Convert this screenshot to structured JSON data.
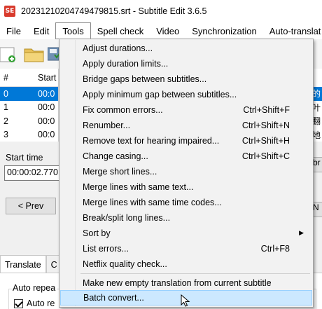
{
  "window": {
    "title": "20231210204749479815.srt - Subtitle Edit 3.6.5",
    "app_icon_text": "SE"
  },
  "menubar": {
    "items": [
      {
        "label": "File"
      },
      {
        "label": "Edit"
      },
      {
        "label": "Tools"
      },
      {
        "label": "Spell check"
      },
      {
        "label": "Video"
      },
      {
        "label": "Synchronization"
      },
      {
        "label": "Auto-translat"
      }
    ]
  },
  "grid": {
    "headers": {
      "num": "#",
      "start": "Start"
    },
    "rows": [
      {
        "num": "0",
        "start": "00:0",
        "text": "的"
      },
      {
        "num": "1",
        "start": "00:0",
        "text": "叶"
      },
      {
        "num": "2",
        "start": "00:0",
        "text": "翻"
      },
      {
        "num": "3",
        "start": "00:0",
        "text": "地"
      }
    ]
  },
  "edit": {
    "start_time_label": "Start time",
    "start_time_value": "00:00:02.770",
    "prev_button": "< Prev",
    "right_button_1": "br",
    "right_button_2": "N"
  },
  "bottom": {
    "tabs": [
      {
        "label": "Translate"
      },
      {
        "label": "C"
      }
    ],
    "group_label": "Auto repea",
    "checkbox_label": "Auto re"
  },
  "tools_menu": {
    "items": [
      {
        "label": "Adjust durations...",
        "shortcut": ""
      },
      {
        "label": "Apply duration limits...",
        "shortcut": ""
      },
      {
        "label": "Bridge gaps between subtitles...",
        "shortcut": ""
      },
      {
        "label": "Apply minimum gap between subtitles...",
        "shortcut": ""
      },
      {
        "label": "Fix common errors...",
        "shortcut": "Ctrl+Shift+F"
      },
      {
        "label": "Renumber...",
        "shortcut": "Ctrl+Shift+N"
      },
      {
        "label": "Remove text for hearing impaired...",
        "shortcut": "Ctrl+Shift+H"
      },
      {
        "label": "Change casing...",
        "shortcut": "Ctrl+Shift+C"
      },
      {
        "label": "Merge short lines...",
        "shortcut": ""
      },
      {
        "label": "Merge lines with same text...",
        "shortcut": ""
      },
      {
        "label": "Merge lines with same time codes...",
        "shortcut": ""
      },
      {
        "label": "Break/split long lines...",
        "shortcut": ""
      },
      {
        "label": "Sort by",
        "shortcut": ""
      },
      {
        "label": "List errors...",
        "shortcut": "Ctrl+F8"
      },
      {
        "label": "Netflix quality check...",
        "shortcut": ""
      },
      {
        "label": "Make new empty translation from current subtitle",
        "shortcut": ""
      },
      {
        "label": "Batch convert...",
        "shortcut": ""
      }
    ]
  },
  "colors": {
    "selection": "#0078d7",
    "menu_highlight": "#cce8ff",
    "app_icon": "#d83a2c"
  }
}
